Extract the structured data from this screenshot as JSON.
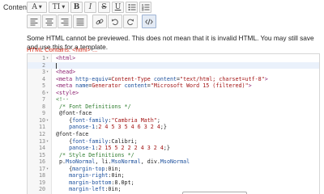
{
  "field_label": "Content",
  "toolbar": {
    "row1": [
      {
        "name": "font-color-button",
        "glyph": "A",
        "dropdown": true
      },
      {
        "name": "font-size-button",
        "glyph": "TI",
        "dropdown": true
      },
      {
        "name": "bold-button",
        "glyph": "B"
      },
      {
        "name": "italic-button",
        "glyph": "I"
      },
      {
        "name": "strikethrough-button",
        "glyph": "S"
      },
      {
        "name": "underline-button",
        "glyph": "U"
      },
      {
        "name": "bullet-list-button",
        "icon": "bullet-list-icon"
      },
      {
        "name": "numbered-list-button",
        "icon": "numbered-list-icon"
      }
    ],
    "row2": [
      {
        "name": "align-left-button",
        "icon": "align-left-icon"
      },
      {
        "name": "align-center-button",
        "icon": "align-center-icon"
      },
      {
        "name": "align-right-button",
        "icon": "align-right-icon"
      },
      {
        "name": "align-justify-button",
        "icon": "align-justify-icon"
      },
      {
        "name": "link-button",
        "icon": "link-icon"
      },
      {
        "name": "undo-button",
        "icon": "undo-icon"
      },
      {
        "name": "redo-button",
        "icon": "redo-icon"
      },
      {
        "name": "html-source-button",
        "icon": "code-icon",
        "active": true
      }
    ]
  },
  "notice": "Some HTML cannot be previewed. This does not mean that it is invalid HTML. You may still save and use this for a template.",
  "warning": "HTML Contains: <html> ...",
  "editor": {
    "current_line": 2,
    "lines": [
      {
        "n": "1",
        "fold": true,
        "tokens": [
          {
            "t": "tag",
            "v": "<html>"
          }
        ]
      },
      {
        "n": "2",
        "fold": false,
        "tokens": []
      },
      {
        "n": "3",
        "fold": true,
        "tokens": [
          {
            "t": "tag",
            "v": "<head>"
          }
        ]
      },
      {
        "n": "4",
        "fold": false,
        "tokens": [
          {
            "t": "tag",
            "v": "<meta "
          },
          {
            "t": "attr",
            "v": "http-equiv"
          },
          {
            "t": "plain",
            "v": "="
          },
          {
            "t": "str",
            "v": "Content-Type"
          },
          {
            "t": "plain",
            "v": " "
          },
          {
            "t": "attr",
            "v": "content"
          },
          {
            "t": "plain",
            "v": "="
          },
          {
            "t": "str",
            "v": "\"text/html; charset=utf-8\""
          },
          {
            "t": "tag",
            "v": ">"
          }
        ]
      },
      {
        "n": "5",
        "fold": false,
        "tokens": [
          {
            "t": "tag",
            "v": "<meta "
          },
          {
            "t": "attr",
            "v": "name"
          },
          {
            "t": "plain",
            "v": "="
          },
          {
            "t": "str",
            "v": "Generator"
          },
          {
            "t": "plain",
            "v": " "
          },
          {
            "t": "attr",
            "v": "content"
          },
          {
            "t": "plain",
            "v": "="
          },
          {
            "t": "str",
            "v": "\"Microsoft Word 15 (filtered)\""
          },
          {
            "t": "tag",
            "v": ">"
          }
        ]
      },
      {
        "n": "6",
        "fold": true,
        "tokens": [
          {
            "t": "tag",
            "v": "<style>"
          }
        ]
      },
      {
        "n": "7",
        "fold": false,
        "tokens": [
          {
            "t": "com",
            "v": "<!--"
          }
        ]
      },
      {
        "n": "8",
        "fold": false,
        "tokens": [
          {
            "t": "com",
            "v": " /* Font Definitions */"
          }
        ]
      },
      {
        "n": "9",
        "fold": false,
        "tokens": [
          {
            "t": "plain",
            "v": " @font-face"
          }
        ]
      },
      {
        "n": "10",
        "fold": true,
        "tokens": [
          {
            "t": "plain",
            "v": "    {"
          },
          {
            "t": "attr",
            "v": "font-family"
          },
          {
            "t": "plain",
            "v": ":"
          },
          {
            "t": "str",
            "v": "\"Cambria Math\""
          },
          {
            "t": "plain",
            "v": ";"
          }
        ]
      },
      {
        "n": "11",
        "fold": false,
        "tokens": [
          {
            "t": "plain",
            "v": "    "
          },
          {
            "t": "attr",
            "v": "panose-1"
          },
          {
            "t": "plain",
            "v": ":"
          },
          {
            "t": "str",
            "v": "2 4 5 3 5 4 6 3 2 4"
          },
          {
            "t": "plain",
            "v": ";}"
          }
        ]
      },
      {
        "n": "12",
        "fold": false,
        "tokens": [
          {
            "t": "plain",
            "v": "@font-face"
          }
        ]
      },
      {
        "n": "13",
        "fold": true,
        "tokens": [
          {
            "t": "plain",
            "v": "    {"
          },
          {
            "t": "attr",
            "v": "font-family"
          },
          {
            "t": "plain",
            "v": ":Calibri;"
          }
        ]
      },
      {
        "n": "14",
        "fold": false,
        "tokens": [
          {
            "t": "plain",
            "v": "    "
          },
          {
            "t": "attr",
            "v": "panose-1"
          },
          {
            "t": "plain",
            "v": ":"
          },
          {
            "t": "str",
            "v": "2 15 5 2 2 2 4 3 2 4"
          },
          {
            "t": "plain",
            "v": ";}"
          }
        ]
      },
      {
        "n": "15",
        "fold": false,
        "tokens": [
          {
            "t": "com",
            "v": " /* Style Definitions */"
          }
        ]
      },
      {
        "n": "16",
        "fold": false,
        "tokens": [
          {
            "t": "plain",
            "v": " p."
          },
          {
            "t": "attr",
            "v": "MsoNormal"
          },
          {
            "t": "plain",
            "v": ", li."
          },
          {
            "t": "attr",
            "v": "MsoNormal"
          },
          {
            "t": "plain",
            "v": ", div."
          },
          {
            "t": "attr",
            "v": "MsoNormal"
          }
        ]
      },
      {
        "n": "17",
        "fold": true,
        "tokens": [
          {
            "t": "plain",
            "v": "    {"
          },
          {
            "t": "attr",
            "v": "margin-top"
          },
          {
            "t": "plain",
            "v": ":0in;"
          }
        ]
      },
      {
        "n": "18",
        "fold": false,
        "tokens": [
          {
            "t": "plain",
            "v": "    "
          },
          {
            "t": "attr",
            "v": "margin-right"
          },
          {
            "t": "plain",
            "v": ":0in;"
          }
        ]
      },
      {
        "n": "19",
        "fold": false,
        "tokens": [
          {
            "t": "plain",
            "v": "    "
          },
          {
            "t": "attr",
            "v": "margin-bottom"
          },
          {
            "t": "plain",
            "v": ":8.0pt;"
          }
        ]
      },
      {
        "n": "20",
        "fold": false,
        "tokens": [
          {
            "t": "plain",
            "v": "    "
          },
          {
            "t": "attr",
            "v": "margin-left"
          },
          {
            "t": "plain",
            "v": ":0in;"
          }
        ]
      }
    ]
  }
}
